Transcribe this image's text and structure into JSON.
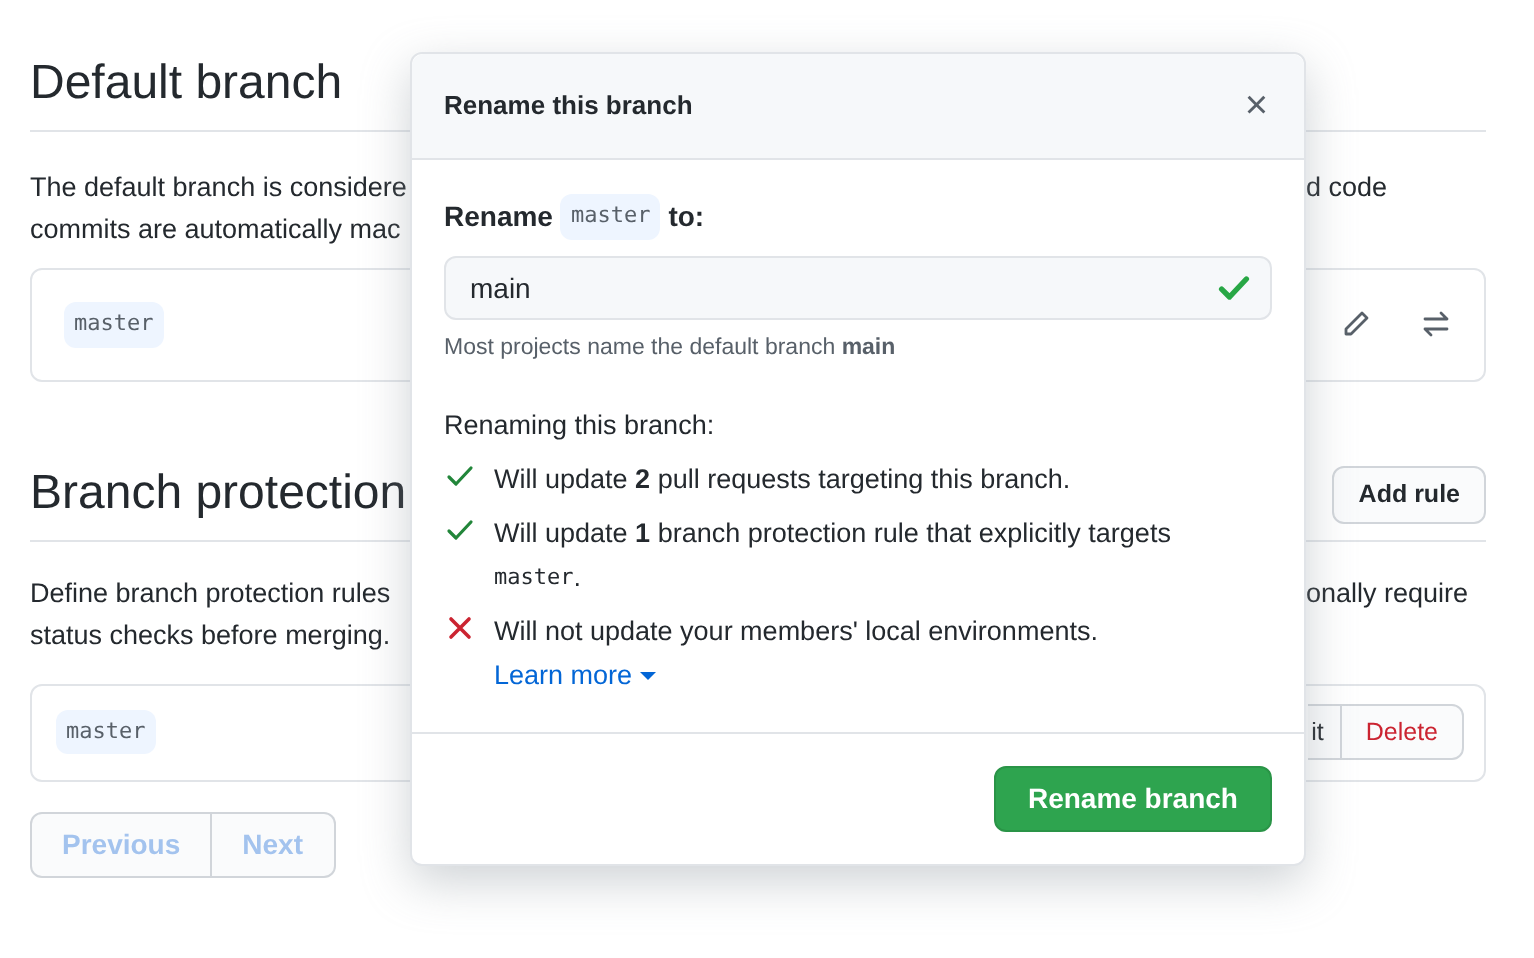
{
  "default_branch": {
    "heading": "Default branch",
    "lines": [
      {
        "left": "The default branch is considere",
        "right": "d code"
      },
      {
        "left": "commits are automatically mac"
      }
    ],
    "branch": "master"
  },
  "branch_protection": {
    "heading": "Branch protection",
    "add_button": "Add rule",
    "lines": [
      {
        "left": "Define branch protection rules",
        "right": "onally require"
      },
      {
        "left": "status checks before merging."
      }
    ],
    "rule": {
      "branch": "master",
      "edit_button": "it",
      "delete_button": "Delete"
    }
  },
  "pagination": [
    {
      "label": "Previous",
      "disabled": true
    },
    {
      "label": "Next",
      "disabled": true
    }
  ],
  "dialog": {
    "title": "Rename this branch",
    "close": "×",
    "label_before": "Rename",
    "label_code": "master",
    "label_after": "to:",
    "input_value": "main",
    "valid": true,
    "hint": "Most projects name the default branch **main**",
    "list_title": "Renaming this branch:",
    "items": [
      {
        "kind": "check",
        "text": "Will update **2** pull requests targeting this branch."
      },
      {
        "kind": "check",
        "text": "Will update **1** branch protection rule that explicitly targets",
        "code": "master",
        "suffix": "."
      },
      {
        "kind": "cross",
        "text": "Will not update your members' local environments.",
        "link": "Learn more"
      }
    ],
    "submit": "Rename branch"
  }
}
